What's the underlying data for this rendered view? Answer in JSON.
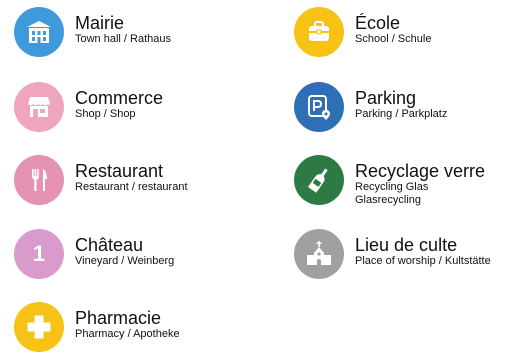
{
  "items": [
    {
      "title": "Mairie",
      "subtitle": "Town hall / Rathaus",
      "icon": "town-hall-icon",
      "color": "#3F9ADB"
    },
    {
      "title": "École",
      "subtitle": "School / Schule",
      "icon": "school-bag-icon",
      "color": "#F5C215"
    },
    {
      "title": "Commerce",
      "subtitle": "Shop / Shop",
      "icon": "shop-icon",
      "color": "#EFA5BE"
    },
    {
      "title": "Parking",
      "subtitle": "Parking / Parkplatz",
      "icon": "parking-icon",
      "color": "#2F6FB6"
    },
    {
      "title": "Restaurant",
      "subtitle": "Restaurant / restaurant",
      "icon": "cutlery-icon",
      "color": "#E493B4"
    },
    {
      "title": "Recyclage verre",
      "subtitle": "Recycling Glas",
      "subtitle2": "Glasrecycling",
      "icon": "glass-bottle-icon",
      "color": "#2E7A45"
    },
    {
      "title": "Château",
      "subtitle": "Vineyard / Weinberg",
      "icon": "number-one-icon",
      "badge": "1",
      "color": "#D99BCB"
    },
    {
      "title": "Lieu de culte",
      "subtitle": "Place of worship / Kultstätte",
      "icon": "church-icon",
      "color": "#A0A0A0"
    },
    {
      "title": "Pharmacie",
      "subtitle": "Pharmacy / Apotheke",
      "icon": "pharmacy-cross-icon",
      "color": "#F5C215"
    }
  ]
}
